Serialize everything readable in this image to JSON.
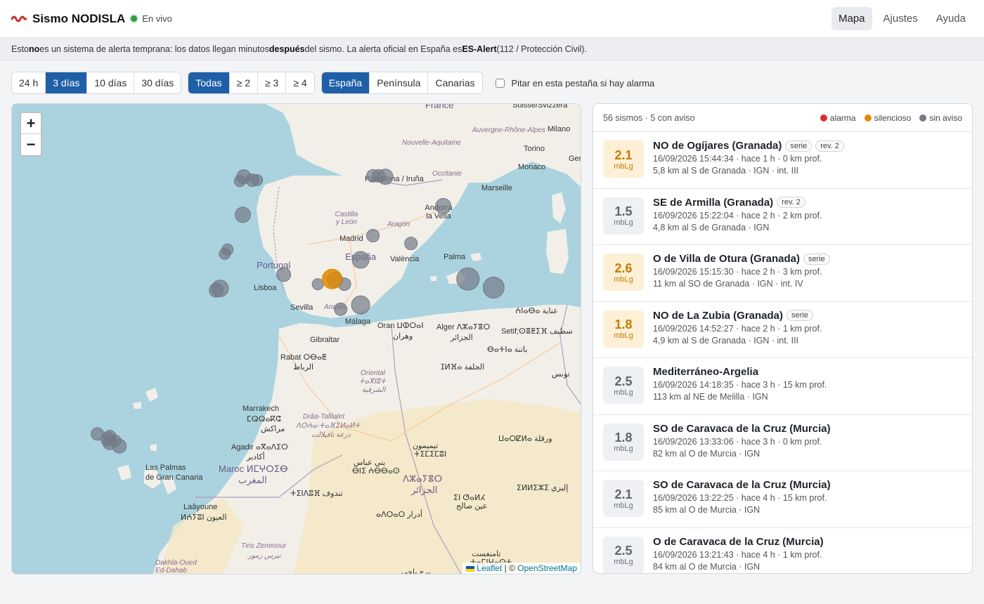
{
  "header": {
    "title": "Sismo NODISLA",
    "live_label": "En vivo",
    "nav": [
      "Mapa",
      "Ajustes",
      "Ayuda"
    ]
  },
  "notice": {
    "p1": "Esto ",
    "b1": "no",
    "p2": " es un sistema de alerta temprana: los datos llegan minutos ",
    "b2": "después",
    "p3": " del sismo. La alerta oficial en España es ",
    "b3": "ES-Alert",
    "p4": " (112 / Protección Civil)."
  },
  "filters": {
    "time": [
      "24 h",
      "3 días",
      "10 días",
      "30 días"
    ],
    "time_selected": 1,
    "magnitude": [
      "Todas",
      "≥ 2",
      "≥ 3",
      "≥ 4"
    ],
    "magnitude_selected": 0,
    "region": [
      "España",
      "Península",
      "Canarias"
    ],
    "region_selected": 0,
    "beep_label": "Pitar en esta pestaña si hay alarma"
  },
  "map": {
    "zoom_in": "+",
    "zoom_out": "−",
    "attribution_leaflet": "Leaflet",
    "attribution_sep": " | © ",
    "attribution_osm": "OpenStreetMap",
    "labels": {
      "france": "France",
      "suisse": "Suisse/Svizzera",
      "milano": "Milano",
      "torino": "Torino",
      "monaco": "Monaco",
      "genova": "Genov",
      "marseille": "Marseille",
      "auvergne": "Auvergne-Rhône-Alpes",
      "nouvelle": "Nouvelle-Aquitaine",
      "occitanie": "Occitanie",
      "pamplona": "Pamplona / Iruña",
      "andorra": "Andorra la Vella",
      "castilla": "Castilla y León",
      "aragon": "Aragón",
      "madrid": "Madrid",
      "espana": "España",
      "valencia": "València",
      "palma": "Palma",
      "portugal": "Portugal",
      "lisboa": "Lisboa",
      "sevilla": "Sevilla",
      "andalucia": "Andalu",
      "malaga": "Málaga",
      "gibraltar": "Gibraltar",
      "oran": "Oran ⵡⵀⵔⴰⵏ",
      "oran_ar": "وهران",
      "alger": "Alger ⴷⵣⴰⵢⴻⵔ",
      "alger_ar": "الجزائر",
      "setif": "Setif;ⵙⴻⵟⵉⴼ سطيف",
      "batna": "ⴱⴰⵜⵏⴰ باتنة",
      "annaba": "ⵄⵏⴰⴱⴰ عنابة",
      "rabat": "Rabat ⵔⴱⴰⵟ",
      "rabat_ar": "الرباط",
      "oriental": "Oriental",
      "oriental2": "ⵜⴰⴳⵏⵓⵜ",
      "oriental_ar": "الشرقية",
      "djelfa": "ⵊⵍⴼⴰ الجلفة",
      "tunis": "تونس",
      "marrakech": "Marrakech",
      "marrakech2": "ⵎⵕⵕⴰⴽⵛ",
      "marrakech_ar": "مراكش",
      "draa": "Drâa-Tafilalet",
      "draa2": "ⴷⵔⵄⴰ-ⵜⴰⴼⵉⵍⴰⵍⵜ",
      "draa_ar": "درعة تافيلالت",
      "agadir": "Agadir ⴰⴳⴰⴷⵉⵔ",
      "agadir_ar": "أكادير",
      "maroc": "Maroc ⵍⵎⵖⵔⵉⴱ",
      "maroc_ar": "المغرب",
      "laspalmas": "Las Palmas",
      "grancanaria": "de Gran Canaria",
      "laayoune": "Laâyoune",
      "laayoune2": "ⵍⵄⵢⵓⵏ العيون",
      "tindouf": "ⵜⵉⵏⴷⵓⴼ تندوف",
      "bechar": "بني عباس",
      "bechar2": "ⴱⵏⵉ ⵄⴱⴱⴰⵙ",
      "timimoun": "تيميمون",
      "timimoun2": "ⵜⵉⵎⵉⵎⵓⵏ",
      "ouargla": "ⵡⴰⵔⵇⵍⴰ ورقلة",
      "algerie": "ⴷⵣⴰⵢⴻⵔ",
      "algerie_ar": "الجزائر",
      "illizi": "ⵉⵍⵍⵉⵣⵉ إليزي",
      "insalah": "ⵉⵏ ⵚⴰⵍⵃ",
      "insalah_ar": "عين صالح",
      "adrar": "ⴰⴷⵔⴰⵔ أدرار",
      "tiris": "Tiris Zemmour",
      "tiris_ar": "تيرس زمور",
      "dakhla": "Dakhla-Oued Ed-Dahab",
      "tamanrasset": "تامنغست",
      "tamanrasset2": "ⵜⴰⵎⵏⵖⴰⵙⵜ",
      "bordj": "برج باجي"
    },
    "quakes": [
      {
        "lat": 43.0,
        "lon": -8.3,
        "r": 10,
        "type": "sin aviso"
      },
      {
        "lat": 42.75,
        "lon": -8.5,
        "r": 8,
        "type": "sin aviso"
      },
      {
        "lat": 42.8,
        "lon": -7.85,
        "r": 9,
        "type": "sin aviso"
      },
      {
        "lat": 42.8,
        "lon": -7.6,
        "r": 8,
        "type": "sin aviso"
      },
      {
        "lat": 43.05,
        "lon": -1.5,
        "r": 9,
        "type": "sin aviso"
      },
      {
        "lat": 43.05,
        "lon": -1.2,
        "r": 9,
        "type": "sin aviso"
      },
      {
        "lat": 43.0,
        "lon": -0.85,
        "r": 11,
        "type": "sin aviso"
      },
      {
        "lat": 41.3,
        "lon": 2.2,
        "r": 11,
        "type": "sin aviso"
      },
      {
        "lat": 40.8,
        "lon": -8.35,
        "r": 11,
        "type": "sin aviso"
      },
      {
        "lat": 39.6,
        "lon": -1.5,
        "r": 9,
        "type": "sin aviso"
      },
      {
        "lat": 39.15,
        "lon": 0.5,
        "r": 9,
        "type": "sin aviso"
      },
      {
        "lat": 38.8,
        "lon": -9.15,
        "r": 8,
        "type": "sin aviso"
      },
      {
        "lat": 38.55,
        "lon": -9.3,
        "r": 8,
        "type": "sin aviso"
      },
      {
        "lat": 38.2,
        "lon": -2.15,
        "r": 12,
        "type": "sin aviso"
      },
      {
        "lat": 37.35,
        "lon": -6.2,
        "r": 10,
        "type": "sin aviso"
      },
      {
        "lat": 37.05,
        "lon": -3.5,
        "r": 11,
        "type": "sin aviso"
      },
      {
        "lat": 36.8,
        "lon": -3.0,
        "r": 9,
        "type": "sin aviso"
      },
      {
        "lat": 36.8,
        "lon": -4.4,
        "r": 8,
        "type": "sin aviso"
      },
      {
        "lat": 36.55,
        "lon": -9.55,
        "r": 12,
        "type": "sin aviso"
      },
      {
        "lat": 36.45,
        "lon": -9.75,
        "r": 10,
        "type": "sin aviso"
      },
      {
        "lat": 37.1,
        "lon": 3.5,
        "r": 16,
        "type": "sin aviso"
      },
      {
        "lat": 36.6,
        "lon": 4.85,
        "r": 15,
        "type": "sin aviso"
      },
      {
        "lat": 35.6,
        "lon": -2.15,
        "r": 13,
        "type": "sin aviso"
      },
      {
        "lat": 35.35,
        "lon": -3.2,
        "r": 9,
        "type": "sin aviso"
      },
      {
        "lat": 37.1,
        "lon": -3.65,
        "r": 14,
        "type": "silencioso"
      },
      {
        "lat": 28.15,
        "lon": -16.0,
        "r": 9,
        "type": "sin aviso"
      },
      {
        "lat": 28.0,
        "lon": -15.35,
        "r": 9,
        "type": "sin aviso"
      },
      {
        "lat": 27.85,
        "lon": -15.45,
        "r": 10,
        "type": "sin aviso"
      },
      {
        "lat": 27.65,
        "lon": -15.35,
        "r": 10,
        "type": "sin aviso"
      },
      {
        "lat": 27.45,
        "lon": -14.85,
        "r": 10,
        "type": "sin aviso"
      },
      {
        "lat": 27.75,
        "lon": -15.05,
        "r": 8,
        "type": "sin aviso"
      }
    ]
  },
  "panel": {
    "summary": "56 sismos · 5 con aviso",
    "legend": [
      {
        "label": "alarma",
        "color": "#d9302c"
      },
      {
        "label": "silencioso",
        "color": "#e08a00"
      },
      {
        "label": "sin aviso",
        "color": "#737b86"
      }
    ],
    "items": [
      {
        "mag": "2.1",
        "unit": "mbLg",
        "warn": true,
        "place": "NO de Ogíjares (Granada)",
        "tags": [
          "serie",
          "rev. 2"
        ],
        "when": "16/09/2026 15:44:34 · hace 1 h · 0 km prof.",
        "where": "5,8 km al S de Granada · IGN · int. III"
      },
      {
        "mag": "1.5",
        "unit": "mbLg",
        "warn": false,
        "place": "SE de Armilla (Granada)",
        "tags": [
          "rev. 2"
        ],
        "when": "16/09/2026 15:22:04 · hace 2 h · 2 km prof.",
        "where": "4,8 km al S de Granada · IGN"
      },
      {
        "mag": "2.6",
        "unit": "mbLg",
        "warn": true,
        "place": "O de Villa de Otura (Granada)",
        "tags": [
          "serie"
        ],
        "when": "16/09/2026 15:15:30 · hace 2 h · 3 km prof.",
        "where": "11 km al SO de Granada · IGN · int. IV"
      },
      {
        "mag": "1.8",
        "unit": "mbLg",
        "warn": true,
        "place": "NO de La Zubia (Granada)",
        "tags": [
          "serie"
        ],
        "when": "16/09/2026 14:52:27 · hace 2 h · 1 km prof.",
        "where": "4,9 km al S de Granada · IGN · int. III"
      },
      {
        "mag": "2.5",
        "unit": "mbLg",
        "warn": false,
        "place": "Mediterráneo-Argelia",
        "tags": [],
        "when": "16/09/2026 14:18:35 · hace 3 h · 15 km prof.",
        "where": "113 km al NE de Melilla · IGN"
      },
      {
        "mag": "1.8",
        "unit": "mbLg",
        "warn": false,
        "place": "SO de Caravaca de la Cruz (Murcia)",
        "tags": [],
        "when": "16/09/2026 13:33:06 · hace 3 h · 0 km prof.",
        "where": "82 km al O de Murcia · IGN"
      },
      {
        "mag": "2.1",
        "unit": "mbLg",
        "warn": false,
        "place": "SO de Caravaca de la Cruz (Murcia)",
        "tags": [],
        "when": "16/09/2026 13:22:25 · hace 4 h · 15 km prof.",
        "where": "85 km al O de Murcia · IGN"
      },
      {
        "mag": "2.5",
        "unit": "mbLg",
        "warn": false,
        "place": "O de Caravaca de la Cruz (Murcia)",
        "tags": [],
        "when": "16/09/2026 13:21:43 · hace 4 h · 1 km prof.",
        "where": "84 km al O de Murcia · IGN"
      }
    ]
  }
}
